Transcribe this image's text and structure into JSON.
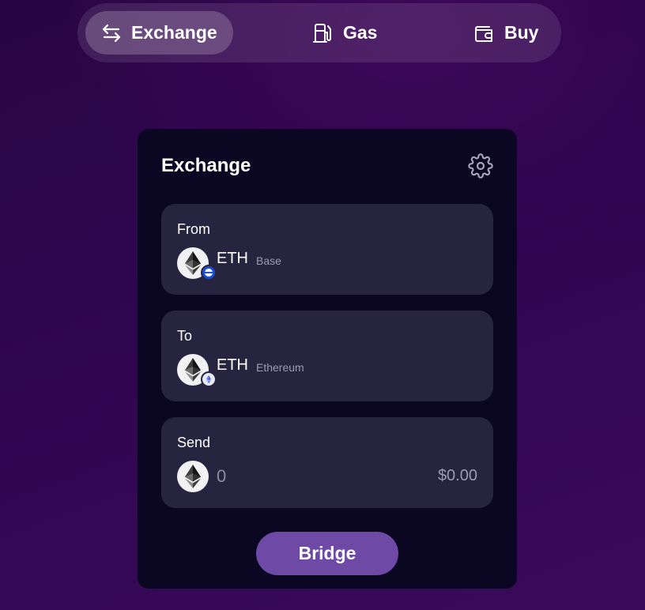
{
  "nav": {
    "tabs": [
      {
        "label": "Exchange",
        "icon": "arrows-exchange-icon",
        "active": true
      },
      {
        "label": "Gas",
        "icon": "gas-pump-icon",
        "active": false
      },
      {
        "label": "Buy",
        "icon": "wallet-icon",
        "active": false
      }
    ]
  },
  "card": {
    "title": "Exchange",
    "settings_icon": "gear-icon",
    "from": {
      "label": "From",
      "token": "ETH",
      "network": "Base",
      "token_icon": "ethereum-icon",
      "chain_badge": "base-chain-icon"
    },
    "to": {
      "label": "To",
      "token": "ETH",
      "network": "Ethereum",
      "token_icon": "ethereum-icon",
      "chain_badge": "ethereum-chain-icon"
    },
    "send": {
      "label": "Send",
      "amount_placeholder": "0",
      "usd_value": "$0.00",
      "token_icon": "ethereum-icon"
    },
    "bridge_label": "Bridge"
  },
  "colors": {
    "background": "#2f0650",
    "card": "#0b0722",
    "panel": "#272440",
    "button": "#6e4aa6",
    "muted_text": "#9c9bb0"
  }
}
